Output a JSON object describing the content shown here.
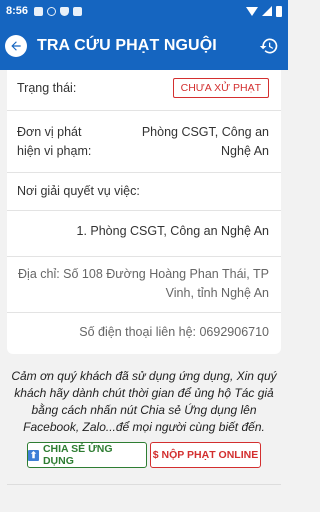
{
  "status_bar": {
    "time": "8:56"
  },
  "app_bar": {
    "title": "TRA CỨU PHẠT NGUỘI"
  },
  "details": {
    "status_label": "Trạng thái:",
    "status_value": "CHƯA XỬ PHẠT",
    "detected_by_label_line1": "Đơn vị phát",
    "detected_by_label_line2": "hiện vi phạm:",
    "detected_by_value_line1": "Phòng CSGT, Công an",
    "detected_by_value_line2": "Nghệ An",
    "resolution_label": "Nơi giải quyết vụ việc:",
    "resolution_office": "1. Phòng CSGT, Công an Nghệ An",
    "address_line1": "Địa chỉ: Số 108 Đường Hoàng Phan Thái, TP",
    "address_line2": "Vinh, tỉnh Nghệ An",
    "phone": "Số điện thoại liên hệ: 0692906710"
  },
  "note": {
    "line1": "Cảm ơn quý khách đã sử dụng ứng dụng, Xin quý",
    "line2": "khách hãy dành chút thời gian để ủng hộ Tác giả",
    "line3": "bằng cách nhấn nút Chia sẻ Ứng dụng lên",
    "line4": "Facebook, Zalo...để mọi người cùng biết đến."
  },
  "buttons": {
    "share_label": "CHIA SẺ ỨNG DỤNG",
    "pay_label": "$ NỘP PHẠT ONLINE"
  },
  "colors": {
    "primary": "#1565c0",
    "danger": "#d32f2f",
    "success": "#2e7d32"
  },
  "icons": {
    "back": "arrow-left-icon",
    "history": "history-icon",
    "share": "upload-icon"
  }
}
